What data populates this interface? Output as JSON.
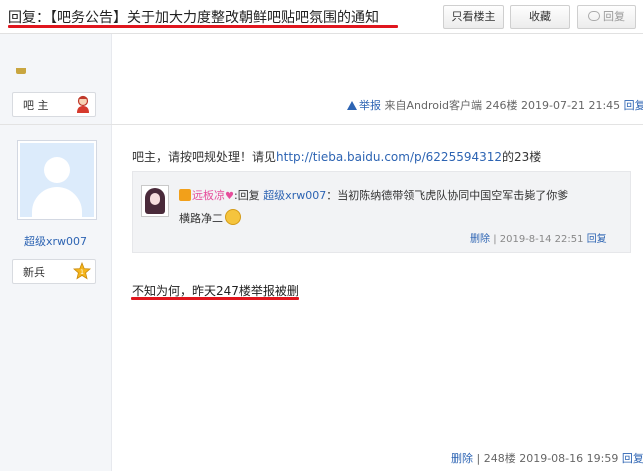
{
  "header": {
    "title": "回复：【吧务公告】关于加大力度整改朝鲜吧贴吧氛围的通知",
    "buttons": {
      "only_host": "只看楼主",
      "favorite": "收藏",
      "reply": "回复"
    }
  },
  "post1": {
    "role": "吧 主",
    "report": "举报",
    "source": "来自Android客户端",
    "floor": "246楼",
    "time": "2019-07-21 21:45",
    "reply": "回复"
  },
  "post2": {
    "username": "超级xrw007",
    "role": "新兵",
    "text_before": "吧主，请按吧规处理！请见",
    "link": "http://tieba.baidu.com/p/6225594312",
    "text_after": "的23楼",
    "quote": {
      "name": "远板凉",
      "reply_word": "回复",
      "reply_to": "超级xrw007",
      "text1": "：当初陈纳德带领飞虎队协同中国空军击毙了你爹",
      "text2": "横路净二",
      "delete": "删除",
      "sep": "|",
      "time": "2019-8-14 22:51",
      "reply": "回复"
    },
    "highlight_text": "不知为何，昨天247楼举报被删",
    "delete": "删除",
    "sep": "|",
    "floor": "248楼",
    "time": "2019-08-16 19:59",
    "reply": "回复"
  },
  "colors": {
    "link": "#2d64b3",
    "highlight_red": "#e0161e",
    "sidebar_bg": "#f4f6f9"
  }
}
